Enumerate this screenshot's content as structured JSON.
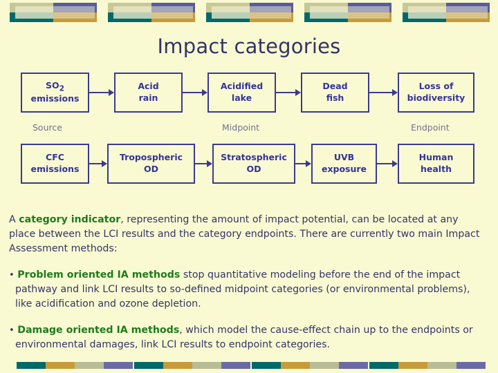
{
  "slide": {
    "title": "Impact categories",
    "background_color": "#FAFAD2",
    "title_color": "#333366",
    "box_border_color": "#3A3A8C",
    "box_text_color": "#333399",
    "stage_label_color": "#707090",
    "highlight_color": "#1E7A1E"
  },
  "decor": {
    "top_band": {
      "name": "top-decorative-band",
      "unit_count": 5,
      "colors": {
        "olive": "#C8C896",
        "purple": "#5B5B9B",
        "teal": "#00696B",
        "gold": "#C89B38",
        "overlay_light": "#E8E8C8"
      }
    },
    "bottom_band": {
      "name": "bottom-decorative-band",
      "unit_count": 5,
      "segment_colors": [
        "#00696B",
        "#C89B38",
        "#B9BD95",
        "#6A6AA6"
      ]
    }
  },
  "diagram": {
    "rows": [
      {
        "id": "so2-pathway",
        "boxes": [
          {
            "line1": "SO",
            "sub": "2",
            "line2": "emissions"
          },
          {
            "line1": "Acid",
            "line2": "rain"
          },
          {
            "line1": "Acidified",
            "line2": "lake"
          },
          {
            "line1": "Dead",
            "line2": "fish"
          },
          {
            "line1": "Loss of",
            "line2": "biodiversity"
          }
        ]
      },
      {
        "id": "cfc-pathway",
        "boxes": [
          {
            "line1": "CFC",
            "line2": "emissions"
          },
          {
            "line1": "Tropospheric",
            "line2": "OD"
          },
          {
            "line1": "Stratospheric",
            "line2": "OD"
          },
          {
            "line1": "UVB",
            "line2": "exposure"
          },
          {
            "line1": "Human",
            "line2": "health"
          }
        ]
      }
    ],
    "stage_labels": [
      {
        "text": "Source"
      },
      {
        "text": "Midpoint"
      },
      {
        "text": "Endpoint"
      }
    ]
  },
  "body": {
    "intro": {
      "pre": "A ",
      "highlight": "category indicator",
      "post": ", representing the amount of impact potential, can be located at any place between the LCI results and the category endpoints. There are currently two main Impact Assessment methods:"
    },
    "bullets": [
      {
        "marker": "•",
        "highlight": "Problem oriented IA methods",
        "rest": " stop quantitative modeling before the end of the impact pathway and link LCI results to so-defined midpoint categories (or environmental problems), like acidification and ozone depletion."
      },
      {
        "marker": "•",
        "highlight": "Damage oriented IA methods",
        "rest": ", which model the cause-effect chain up to the endpoints or environmental damages, link LCI results to endpoint categories."
      }
    ]
  }
}
